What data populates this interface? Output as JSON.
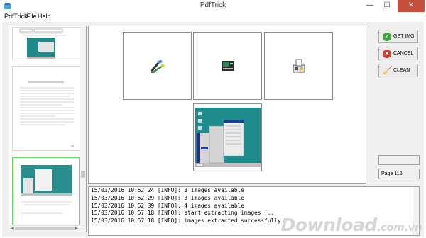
{
  "window": {
    "title": "PdfTrick",
    "minimize": "—",
    "maximize": "☐",
    "close": "✕"
  },
  "menu": [
    "PdfTrick",
    "File",
    "Help"
  ],
  "buttons": {
    "get_img": "GET IMG",
    "cancel": "CANCEL",
    "clean": "CLEAN"
  },
  "status": {
    "page": "Page 112"
  },
  "log": [
    "15/03/2016 10:52:24 [INFO]: 3 images available",
    "15/03/2016 10:52:29 [INFO]: 3 images available",
    "15/03/2016 10:52:39 [INFO]: 4 images available",
    "15/03/2016 10:57:18 [INFO]: start extracting images ...",
    "15/03/2016 10:57:18 [INFO]: images extracted successfully"
  ],
  "watermark": {
    "main": "Download",
    "suffix": ".com.vn"
  },
  "colors": {
    "accept": "#3aa33a",
    "cancel": "#d23c2c",
    "clean": "#e0b020",
    "selection": "#5ce05c",
    "close": "#c74f3c"
  },
  "icons": {
    "cell1": "tools-icon",
    "cell2": "printer-icon",
    "cell3": "fax-machine-icon"
  }
}
